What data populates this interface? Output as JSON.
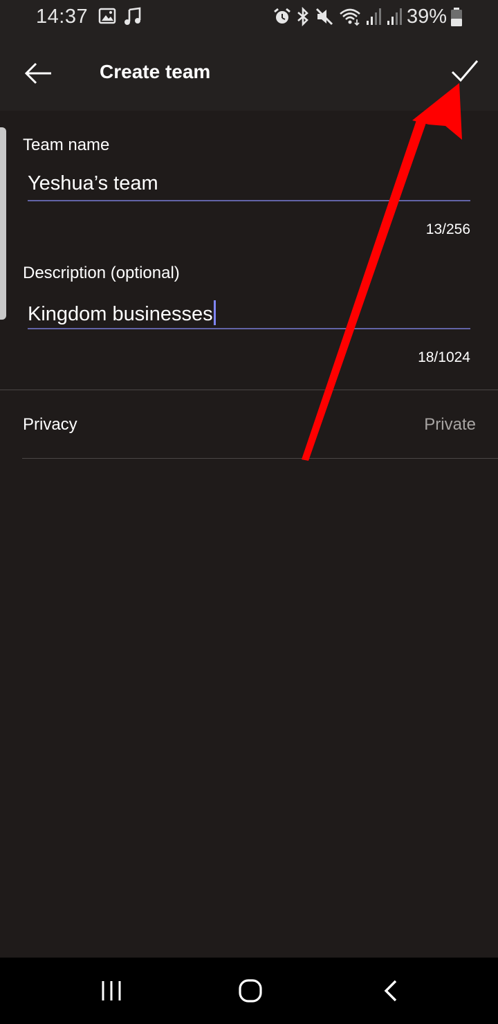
{
  "status_bar": {
    "time": "14:37",
    "battery": "39%",
    "icons": [
      "image-icon",
      "music-icon",
      "alarm-icon",
      "bluetooth-icon",
      "mute-icon",
      "wifi-icon",
      "signal-icon",
      "signal-icon",
      "battery-icon"
    ]
  },
  "app_bar": {
    "title": "Create team",
    "back_icon": "arrow-left-icon",
    "done_icon": "checkmark-icon"
  },
  "form": {
    "team_name": {
      "label": "Team name",
      "value": "Yeshua’s team",
      "counter": "13/256"
    },
    "description": {
      "label": "Description (optional)",
      "value": "Kingdom businesses",
      "counter": "18/1024"
    },
    "privacy": {
      "label": "Privacy",
      "value": "Private"
    }
  },
  "nav_bar": {
    "icons": [
      "recent-apps-icon",
      "home-icon",
      "back-icon"
    ]
  },
  "colors": {
    "background": "#1f1b1a",
    "header": "#242120",
    "accent": "#6264a7",
    "annotation": "#ff0000"
  }
}
